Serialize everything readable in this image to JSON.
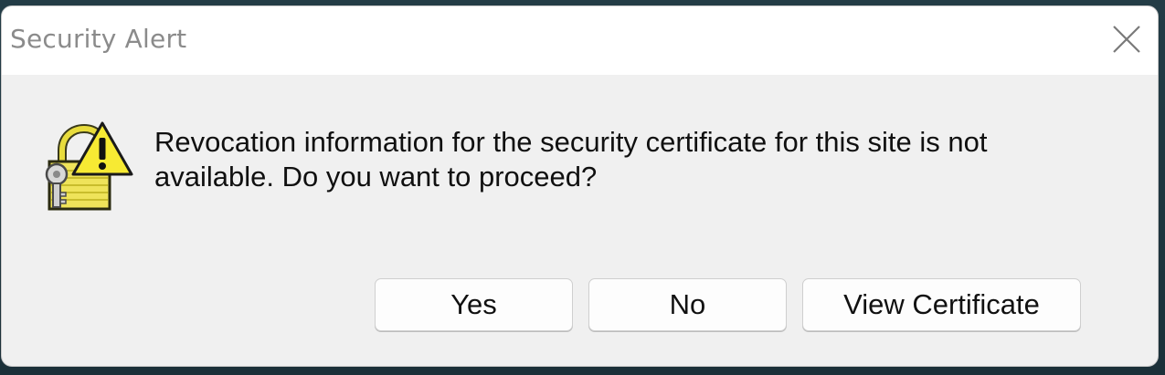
{
  "dialog": {
    "title": "Security Alert",
    "message_line1": "Revocation information for the security certificate for this site is not",
    "message_line2": "available. Do you want to proceed?",
    "icon": "padlock-warning-icon",
    "close_icon": "close-icon"
  },
  "buttons": {
    "yes_label": "Yes",
    "no_label": "No",
    "view_certificate_label": "View Certificate"
  },
  "colors": {
    "dialog_bg": "#f0f0f0",
    "titlebar_bg": "#ffffff",
    "title_text": "#8b8b8b",
    "warning_yellow": "#f5e640"
  }
}
